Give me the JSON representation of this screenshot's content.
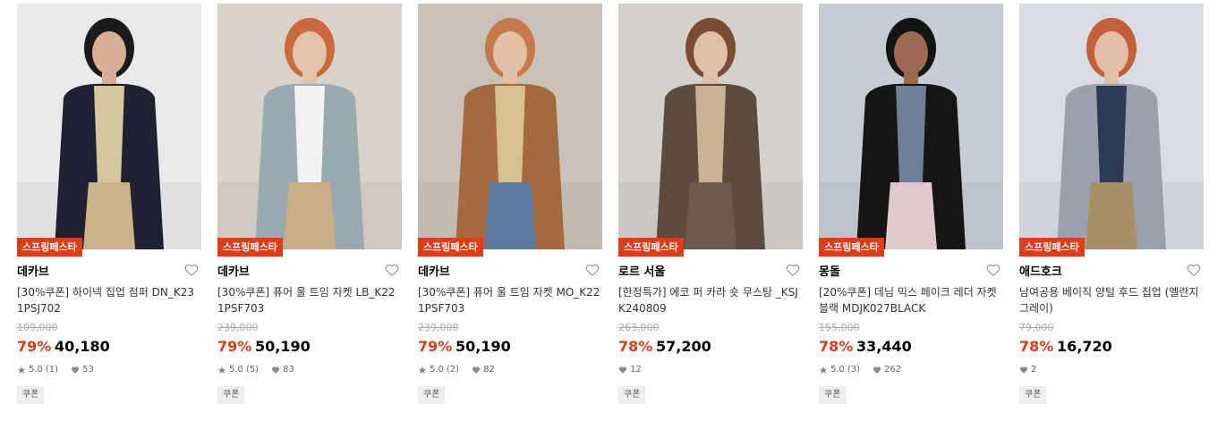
{
  "products": [
    {
      "badge": "스프링페스타",
      "brand": "데카브",
      "name": "[30%쿠폰] 하이넥 집업 점퍼 DN_K231PSJ702",
      "original_price": "109,000",
      "discount": "79%",
      "price": "40,180",
      "rating": "5.0",
      "review_count": "(1)",
      "likes": "53",
      "coupon": "쿠폰",
      "has_rating": true,
      "colors": {
        "bg": "#eaeaea",
        "hair": "#1b1b1b",
        "skin": "#d8ae94",
        "jacket": "#1e2230",
        "inner": "#d6c79f",
        "pants": "#cbb28a"
      }
    },
    {
      "badge": "스프링페스타",
      "brand": "데카브",
      "name": "[30%쿠폰] 퓨어 울 트임 자켓 LB_K221PSF703",
      "original_price": "239,000",
      "discount": "79%",
      "price": "50,190",
      "rating": "5.0",
      "review_count": "(5)",
      "likes": "83",
      "coupon": "쿠폰",
      "has_rating": true,
      "colors": {
        "bg": "#d9d2c8",
        "hair": "#c86a3e",
        "skin": "#e4c3ad",
        "jacket": "#9aaab0",
        "inner": "#f2f2f2",
        "pants": "#c9ad86"
      }
    },
    {
      "badge": "스프링페스타",
      "brand": "데카브",
      "name": "[30%쿠폰] 퓨어 울 트임 자켓 MO_K221PSF703",
      "original_price": "239,000",
      "discount": "79%",
      "price": "50,190",
      "rating": "5.0",
      "review_count": "(2)",
      "likes": "82",
      "coupon": "쿠폰",
      "has_rating": true,
      "colors": {
        "bg": "#c9c2b9",
        "hair": "#c67a4c",
        "skin": "#e3c0a5",
        "jacket": "#a46a3e",
        "inner": "#d7c08f",
        "pants": "#5a7aa0"
      }
    },
    {
      "badge": "스프링페스타",
      "brand": "로르 서울",
      "name": "[한정특가] 에코 퍼 카라 숏 무스탕 _KSJK240809",
      "original_price": "263,000",
      "discount": "78%",
      "price": "57,200",
      "rating": "",
      "review_count": "",
      "likes": "12",
      "coupon": "쿠폰",
      "has_rating": false,
      "colors": {
        "bg": "#d4d1cd",
        "hair": "#7a4c33",
        "skin": "#e0bfa8",
        "jacket": "#5c4c3f",
        "inner": "#c9b492",
        "pants": "#6c5a4a"
      }
    },
    {
      "badge": "스프링페스타",
      "brand": "몽돌",
      "name": "[20%쿠폰] 데님 믹스 페이크 레더 자켓 블랙 MDJK027BLACK",
      "original_price": "155,000",
      "discount": "78%",
      "price": "33,440",
      "rating": "5.0",
      "review_count": "(3)",
      "likes": "262",
      "coupon": "쿠폰",
      "has_rating": true,
      "colors": {
        "bg": "#c5ccd2",
        "hair": "#141414",
        "skin": "#9a6a51",
        "jacket": "#151515",
        "inner": "#6f7f96",
        "pants": "#e0c9cc"
      }
    },
    {
      "badge": "스프링페스타",
      "brand": "애드호크",
      "name": "남여공용 베이직 양털 후드 집업 (멜란지그레이)",
      "original_price": "79,000",
      "discount": "78%",
      "price": "16,720",
      "rating": "",
      "review_count": "",
      "likes": "2",
      "coupon": "쿠폰",
      "has_rating": false,
      "colors": {
        "bg": "#d7dde2",
        "hair": "#c1603a",
        "skin": "#e4bea5",
        "jacket": "#9aa1ac",
        "inner": "#2e3a55",
        "pants": "#a79068"
      }
    }
  ],
  "icons": {
    "favorite": "heart-outline-icon",
    "rating": "star-icon",
    "likes": "heart-filled-icon"
  },
  "accent_color": "#e33b14"
}
